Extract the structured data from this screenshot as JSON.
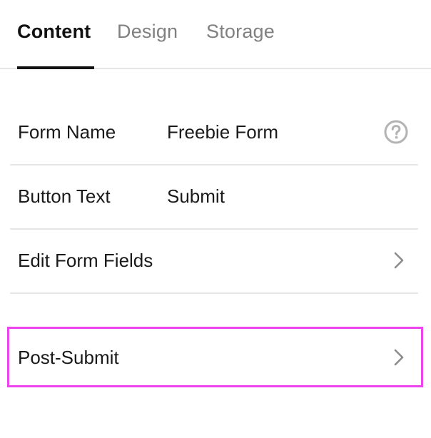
{
  "tabs": [
    {
      "label": "Content",
      "active": true
    },
    {
      "label": "Design",
      "active": false
    },
    {
      "label": "Storage",
      "active": false
    }
  ],
  "rows": {
    "form_name": {
      "label": "Form Name",
      "value": "Freebie Form",
      "icon": "help-icon"
    },
    "button_text": {
      "label": "Button Text",
      "value": "Submit"
    },
    "edit_form_fields": {
      "label": "Edit Form Fields",
      "icon": "chevron-right-icon"
    },
    "post_submit": {
      "label": "Post-Submit",
      "icon": "chevron-right-icon",
      "highlight_color": "#ee44ee"
    }
  }
}
